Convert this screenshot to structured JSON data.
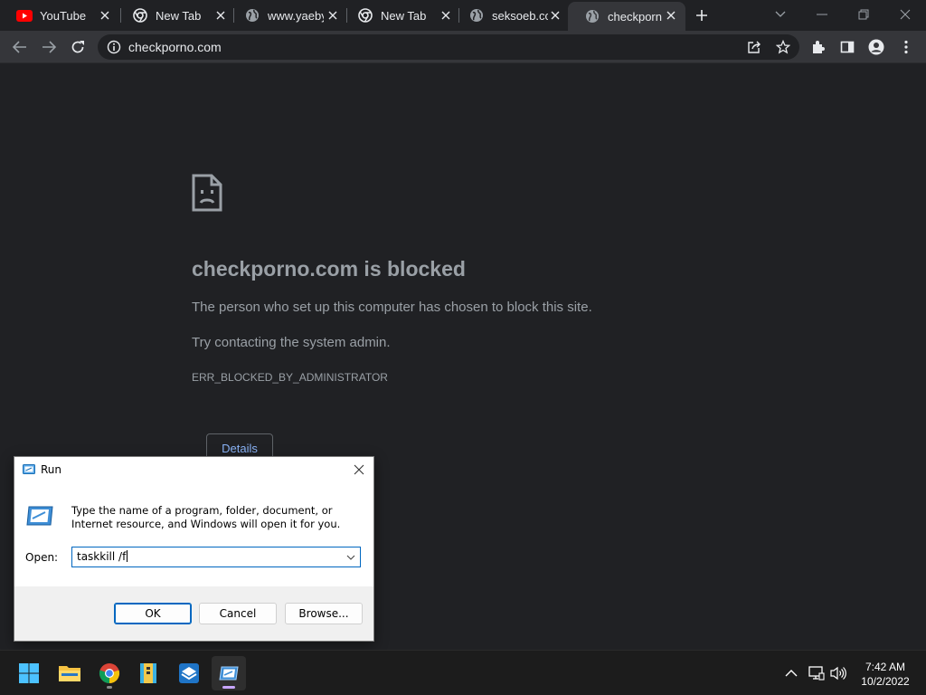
{
  "browser": {
    "tabs": [
      {
        "title": "YouTube",
        "favicon": "youtube-icon"
      },
      {
        "title": "New Tab",
        "favicon": "chrome-icon"
      },
      {
        "title": "www.yaeby",
        "favicon": "globe-icon"
      },
      {
        "title": "New Tab",
        "favicon": "chrome-icon"
      },
      {
        "title": "seksoeb.co",
        "favicon": "globe-icon"
      },
      {
        "title": "checkporn",
        "favicon": "globe-icon",
        "active": true
      }
    ],
    "url": "checkporno.com"
  },
  "error_page": {
    "title": "checkporno.com is blocked",
    "line1": "The person who set up this computer has chosen to block this site.",
    "line2": "Try contacting the system admin.",
    "code": "ERR_BLOCKED_BY_ADMINISTRATOR",
    "details_label": "Details"
  },
  "run_dialog": {
    "title": "Run",
    "description": "Type the name of a program, folder, document, or Internet resource, and Windows will open it for you.",
    "open_label": "Open:",
    "input_value": "taskkill /f",
    "ok_label": "OK",
    "cancel_label": "Cancel",
    "browse_label": "Browse..."
  },
  "taskbar": {
    "apps": [
      "start-icon",
      "file-explorer-icon",
      "chrome-icon",
      "archive-icon",
      "installer-icon",
      "run-icon"
    ],
    "time": "7:42 AM",
    "date": "10/2/2022"
  },
  "colors": {
    "page_bg": "#202124",
    "toolbar_bg": "#35363a",
    "link_blue": "#8ab4f8",
    "text_gray": "#9aa0a6",
    "accent_blue": "#0067c0"
  }
}
